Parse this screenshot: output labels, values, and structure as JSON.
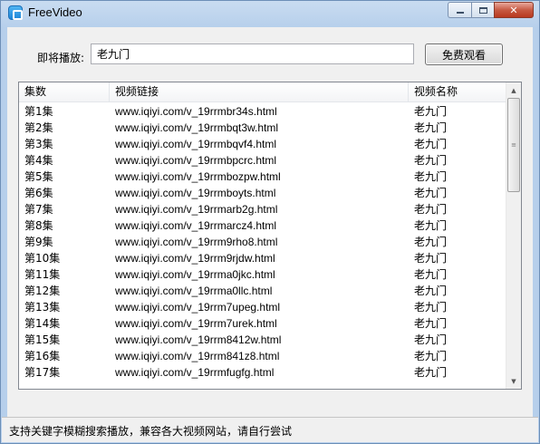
{
  "window": {
    "title": "FreeVideo",
    "controls": {
      "minimize": "minimize",
      "maximize": "maximize",
      "close": "✕"
    }
  },
  "toolbar": {
    "play_label": "即将播放:",
    "search_value": "老九门",
    "watch_button": "免费观看"
  },
  "table": {
    "columns": [
      "集数",
      "视频链接",
      "视频名称"
    ],
    "rows": [
      {
        "ep": "第1集",
        "url": "www.iqiyi.com/v_19rrmbr34s.html",
        "name": "老九门"
      },
      {
        "ep": "第2集",
        "url": "www.iqiyi.com/v_19rrmbqt3w.html",
        "name": "老九门"
      },
      {
        "ep": "第3集",
        "url": "www.iqiyi.com/v_19rrmbqvf4.html",
        "name": "老九门"
      },
      {
        "ep": "第4集",
        "url": "www.iqiyi.com/v_19rrmbpcrc.html",
        "name": "老九门"
      },
      {
        "ep": "第5集",
        "url": "www.iqiyi.com/v_19rrmbozpw.html",
        "name": "老九门"
      },
      {
        "ep": "第6集",
        "url": "www.iqiyi.com/v_19rrmboyts.html",
        "name": "老九门"
      },
      {
        "ep": "第7集",
        "url": "www.iqiyi.com/v_19rrmarb2g.html",
        "name": "老九门"
      },
      {
        "ep": "第8集",
        "url": "www.iqiyi.com/v_19rrmarcz4.html",
        "name": "老九门"
      },
      {
        "ep": "第9集",
        "url": "www.iqiyi.com/v_19rrm9rho8.html",
        "name": "老九门"
      },
      {
        "ep": "第10集",
        "url": "www.iqiyi.com/v_19rrm9rjdw.html",
        "name": "老九门"
      },
      {
        "ep": "第11集",
        "url": "www.iqiyi.com/v_19rrma0jkc.html",
        "name": "老九门"
      },
      {
        "ep": "第12集",
        "url": "www.iqiyi.com/v_19rrma0llc.html",
        "name": "老九门"
      },
      {
        "ep": "第13集",
        "url": "www.iqiyi.com/v_19rrm7upeg.html",
        "name": "老九门"
      },
      {
        "ep": "第14集",
        "url": "www.iqiyi.com/v_19rrm7urek.html",
        "name": "老九门"
      },
      {
        "ep": "第15集",
        "url": "www.iqiyi.com/v_19rrm8412w.html",
        "name": "老九门"
      },
      {
        "ep": "第16集",
        "url": "www.iqiyi.com/v_19rrm841z8.html",
        "name": "老九门"
      },
      {
        "ep": "第17集",
        "url": "www.iqiyi.com/v_19rrmfugfg.html",
        "name": "老九门"
      }
    ]
  },
  "status": {
    "text": "支持关键字模糊搜索播放，兼容各大视频网站，请自行尝试"
  }
}
